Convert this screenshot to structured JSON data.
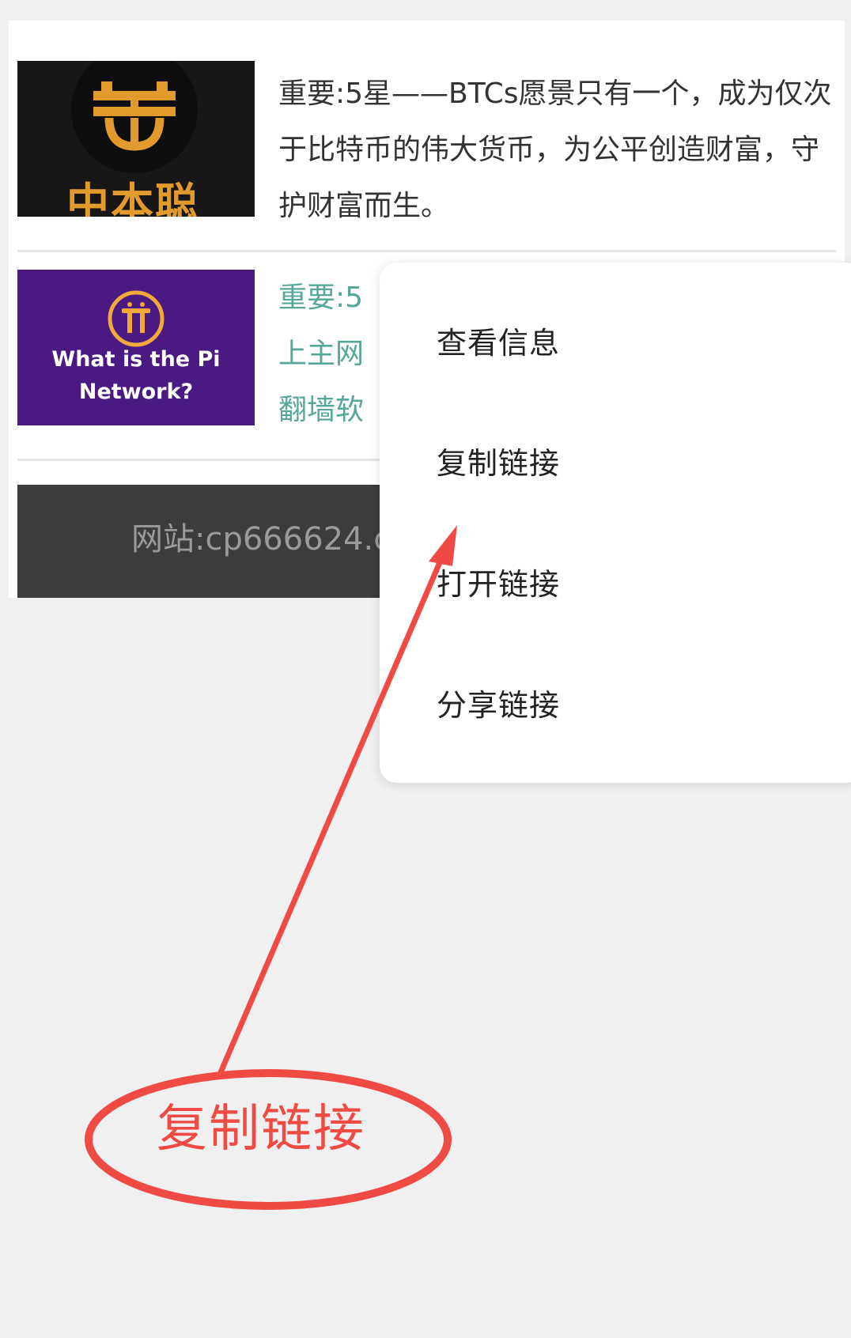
{
  "articles": [
    {
      "thumbnail_text": "中本聪",
      "text": "重要:5星——BTCs愿景只有一个，成为仅次于比特币的伟大货币，为公平创造财富，守护财富而生。"
    },
    {
      "thumbnail_text": "What is the Pi Network?",
      "text_lines": [
        "重要:5",
        "上主网",
        "翻墙软"
      ]
    }
  ],
  "footer": {
    "site_text": "网站:cp666624.c"
  },
  "context_menu": {
    "items": [
      "查看信息",
      "复制链接",
      "打开链接",
      "分享链接"
    ]
  },
  "annotation": {
    "label": "复制链接",
    "color": "#f04a44"
  }
}
